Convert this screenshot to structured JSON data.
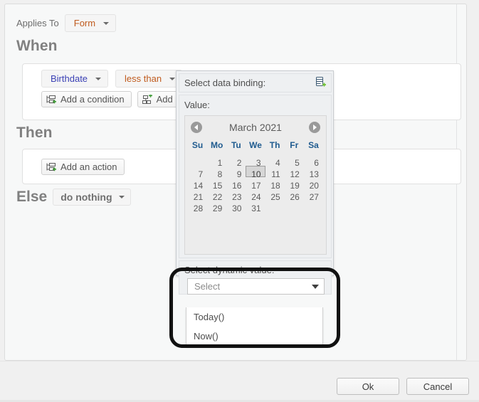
{
  "applies_to": {
    "label": "Applies To",
    "value": "Form"
  },
  "sections": {
    "when_title": "When",
    "then_title": "Then",
    "else_word": "Else",
    "else_value": "do nothing"
  },
  "condition": {
    "field": "Birthdate",
    "operator": "less than",
    "add_condition": "Add a condition",
    "add_conditions_group": "Add a co"
  },
  "then": {
    "add_action": "Add an action"
  },
  "popup": {
    "header_label": "Select data binding:",
    "binding_icon": "database-add-icon",
    "value_label": "Value:",
    "dynamic_label": "Select dynamic value:",
    "dynamic_placeholder": "Select",
    "dynamic_options": [
      "Today()",
      "Now()"
    ]
  },
  "calendar": {
    "month_label": "March 2021",
    "prev_icon": "chevron-left-icon",
    "next_icon": "chevron-right-icon",
    "day_headers": [
      "Su",
      "Mo",
      "Tu",
      "We",
      "Th",
      "Fr",
      "Sa"
    ],
    "leading_blanks": 1,
    "days": [
      1,
      2,
      3,
      4,
      5,
      6,
      7,
      8,
      9,
      10,
      11,
      12,
      13,
      14,
      15,
      16,
      17,
      18,
      19,
      20,
      21,
      22,
      23,
      24,
      25,
      26,
      27,
      28,
      29,
      30,
      31
    ],
    "selected_day": 10
  },
  "footer": {
    "ok": "Ok",
    "cancel": "Cancel"
  },
  "colors": {
    "field_blue": "#3b41b5",
    "operator_orange": "#c05b1e",
    "day_header_blue": "#1f5b8f",
    "annotation_black": "#111111",
    "heading_gray": "#808080"
  }
}
